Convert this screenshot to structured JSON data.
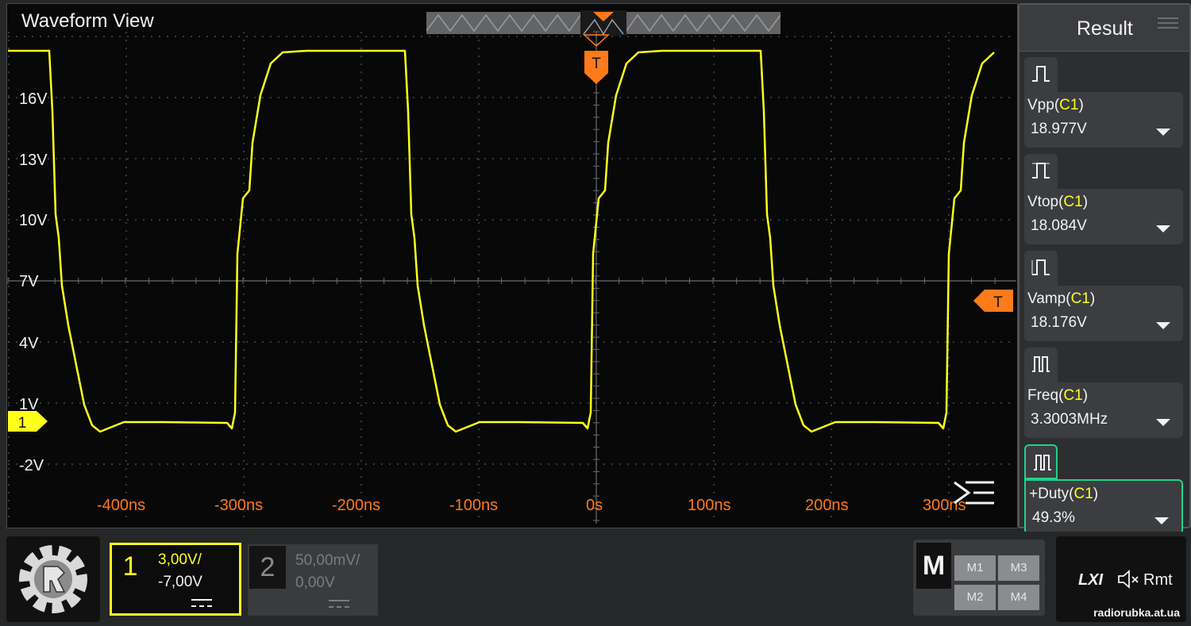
{
  "title": "Waveform View",
  "colors": {
    "trace": "#ffff1a",
    "trigger": "#ff7a1a",
    "accent": "#1fd28a"
  },
  "voltage_labels": [
    "16V",
    "13V",
    "10V",
    "7V",
    "4V",
    "1V",
    "-2V"
  ],
  "time_labels": [
    "-400ns",
    "-300ns",
    "-200ns",
    "-100ns",
    "0s",
    "100ns",
    "200ns",
    "300ns"
  ],
  "trigger_label": "T",
  "channel_marker": "1",
  "result_panel": {
    "title": "Result",
    "items": [
      {
        "name": "Vpp",
        "source": "C1",
        "value": "18.977V"
      },
      {
        "name": "Vtop",
        "source": "C1",
        "value": "18.084V"
      },
      {
        "name": "Vamp",
        "source": "C1",
        "value": "18.176V"
      },
      {
        "name": "Freq",
        "source": "C1",
        "value": "3.3003MHz"
      },
      {
        "name": "+Duty",
        "source": "C1",
        "value": "49.3%"
      }
    ]
  },
  "channels": [
    {
      "num": "1",
      "scale": "3,00V/",
      "offset": "-7,00V"
    },
    {
      "num": "2",
      "scale": "50,00mV/",
      "offset": "0,00V"
    }
  ],
  "math": {
    "label": "M",
    "buttons": [
      "M1",
      "M3",
      "M2",
      "M4"
    ]
  },
  "status": {
    "lxi": "LXI",
    "remote": "Rmt"
  },
  "watermark": "radiorubka.at.ua"
}
